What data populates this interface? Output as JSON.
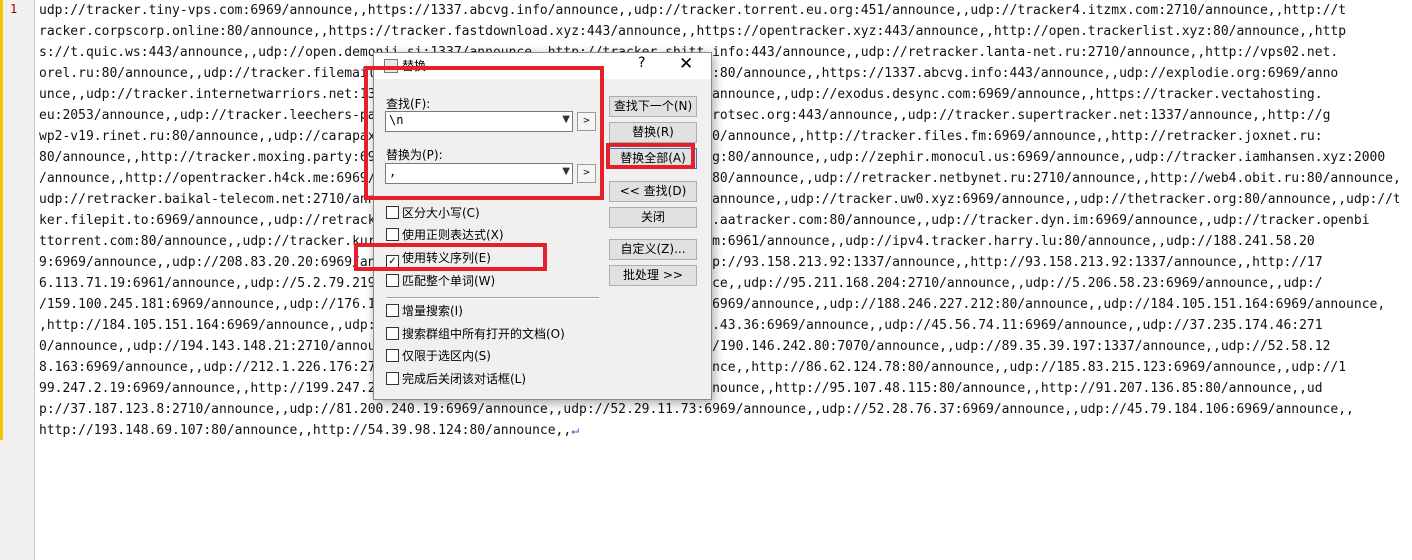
{
  "editor": {
    "line_number": "1",
    "eol_marker": "↵",
    "lines": [
      "udp://tracker.tiny-vps.com:6969/announce,,https://1337.abcvg.info/announce,,udp://tracker.torrent.eu.org:451/announce,,udp://tracker4.itzmx.com:2710/announce,,http://t",
      "racker.corpscorp.online:80/announce,,https://tracker.fastdownload.xyz:443/announce,,https://opentracker.xyz:443/announce,,http://open.trackerlist.xyz:80/announce,,http",
      "s://t.quic.ws:443/announce,,udp://open.demonii.si:1337/announce,,http://tracker.shitt.info:443/announce,,udp://retracker.lanta-net.ru:2710/announce,,http://vps02.net.",
      "orel.ru:80/announce,,udp://tracker.filemail.com:6969/announce,,http://tracker.bt4g.org:80/announce,,https://1337.abcvg.info:443/announce,,udp://explodie.org:6969/anno",
      "unce,,udp://tracker.internetwarriors.net:1337/announce,,udp://tracker.moeking.me:6969/announce,,udp://exodus.desync.com:6969/announce,,https://tracker.vectahosting.",
      "eu:2053/announce,,udp://tracker.leechers-paradise.org:6969/announce,,udp://tracker.parrotsec.org:443/announce,,udp://tracker.supertracker.net:1337/announce,,http://g",
      "wp2-v19.rinet.ru:80/announce,,udp://carapax.net:6969/announce,,http://tracker.krg.ua:80/announce,,http://tracker.files.fm:6969/announce,,http://retracker.joxnet.ru:",
      "80/announce,,http://tracker.moxing.party:6969/announce,,udp://tracker.tvunderground.org:80/announce,,udp://zephir.monocul.us:6969/announce,,udp://tracker.iamhansen.xyz:2000",
      "/announce,,http://opentracker.h4ck.me:6969/announce,,udp://tracker.openbittorrent.com:80/announce,,udp://retracker.netbynet.ru:2710/announce,,http://web4.obit.ru:80/announce,,",
      "udp://retracker.baikal-telecom.net:2710/announce,,udp://tracker.supertracker.net:1337/announce,,udp://tracker.uw0.xyz:6969/announce,,udp://thetracker.org:80/announce,,udp://trac",
      "ker.filepit.to:6969/announce,,udp://retracker.sevstar.net:2710/announce,,udp://tracker.aatracker.com:80/announce,,udp://tracker.dyn.im:6969/announce,,udp://tracker.openbi",
      "ttorrent.com:80/announce,,udp://tracker.kuroy.me:5944/announce,,udp://tracker.itzmx.com:6961/announce,,udp://ipv4.tracker.harry.lu:80/announce,,udp://188.241.58.20",
      "9:6969/announce,,udp://208.83.20.20:6969/announce,,udp://185.181.60.67:80/announce,,udp://93.158.213.92:1337/announce,,http://93.158.213.92:1337/announce,,http://17",
      "6.113.71.19:6961/announce,,udp://5.2.79.219:1337/announce,,udp://5.2.79.22:6969/announce,,udp://95.211.168.204:2710/announce,,udp://5.206.58.23:6969/announce,,udp:/",
      "/159.100.245.181:6969/announce,,udp://176.113.71.19:6961/announce,,udp://51.15.40.114:6969/announce,,udp://188.246.227.212:80/announce,,udp://184.105.151.164:6969/announce,",
      ",http://184.105.151.164:6969/announce,,udp://91.216.110.52:451/announce,,udp://199.248.43.36:6969/announce,,udp://45.56.74.11:6969/announce,,udp://37.235.174.46:271",
      "0/announce,,udp://194.143.148.21:2710/announce,,udp://37.1.205.89:2710/announce,,udp://190.146.242.80:7070/announce,,udp://89.35.39.197:1337/announce,,udp://52.58.12",
      "8.163:6969/announce,,udp://212.1.226.176:2710/announce,,udp://128.199.70.66:5944/announce,,http://86.62.124.78:80/announce,,udp://185.83.215.123:6969/announce,,udp://1",
      "99.247.2.19:6969/announce,,http://199.247.2.19:6969/announce,,udp://51.15.4.13:1337/announce,,http://95.107.48.115:80/announce,,http://91.207.136.85:80/announce,,ud",
      "p://37.187.123.8:2710/announce,,udp://81.200.240.19:6969/announce,,udp://52.29.11.73:6969/announce,,udp://52.28.76.37:6969/announce,,udp://45.79.184.106:6969/announce,,",
      "http://193.148.69.107:80/announce,,http://54.39.98.124:80/announce,,"
    ]
  },
  "dialog": {
    "title": "替换",
    "help_label": "?",
    "close_label": "✕",
    "find_label": "查找(F):",
    "find_value": "\\n",
    "replace_label": "替换为(P):",
    "replace_value": ",",
    "small_button_label": ">",
    "options": {
      "match_case": {
        "label": "区分大小写(C)",
        "checked": false
      },
      "regex": {
        "label": "使用正则表达式(X)",
        "checked": false
      },
      "escape": {
        "label": "使用转义序列(E)",
        "checked": true
      },
      "whole_word": {
        "label": "匹配整个单词(W)",
        "checked": false
      },
      "incremental": {
        "label": "增量搜索(I)",
        "checked": false
      },
      "all_docs": {
        "label": "搜索群组中所有打开的文档(O)",
        "checked": false
      },
      "selection_only": {
        "label": "仅限于选区内(S)",
        "checked": false
      },
      "close_after": {
        "label": "完成后关闭该对话框(L)",
        "checked": false
      }
    },
    "buttons": {
      "find_next": "查找下一个(N)",
      "replace": "替换(R)",
      "replace_all": "替换全部(A)",
      "find_prev": "<< 查找(D)",
      "close": "关闭",
      "customize": "自定义(Z)...",
      "batch": "批处理 >>"
    }
  },
  "colors": {
    "highlight": "#e5202a",
    "change_bar": "#f5c400",
    "eol": "#1a6fd1"
  }
}
